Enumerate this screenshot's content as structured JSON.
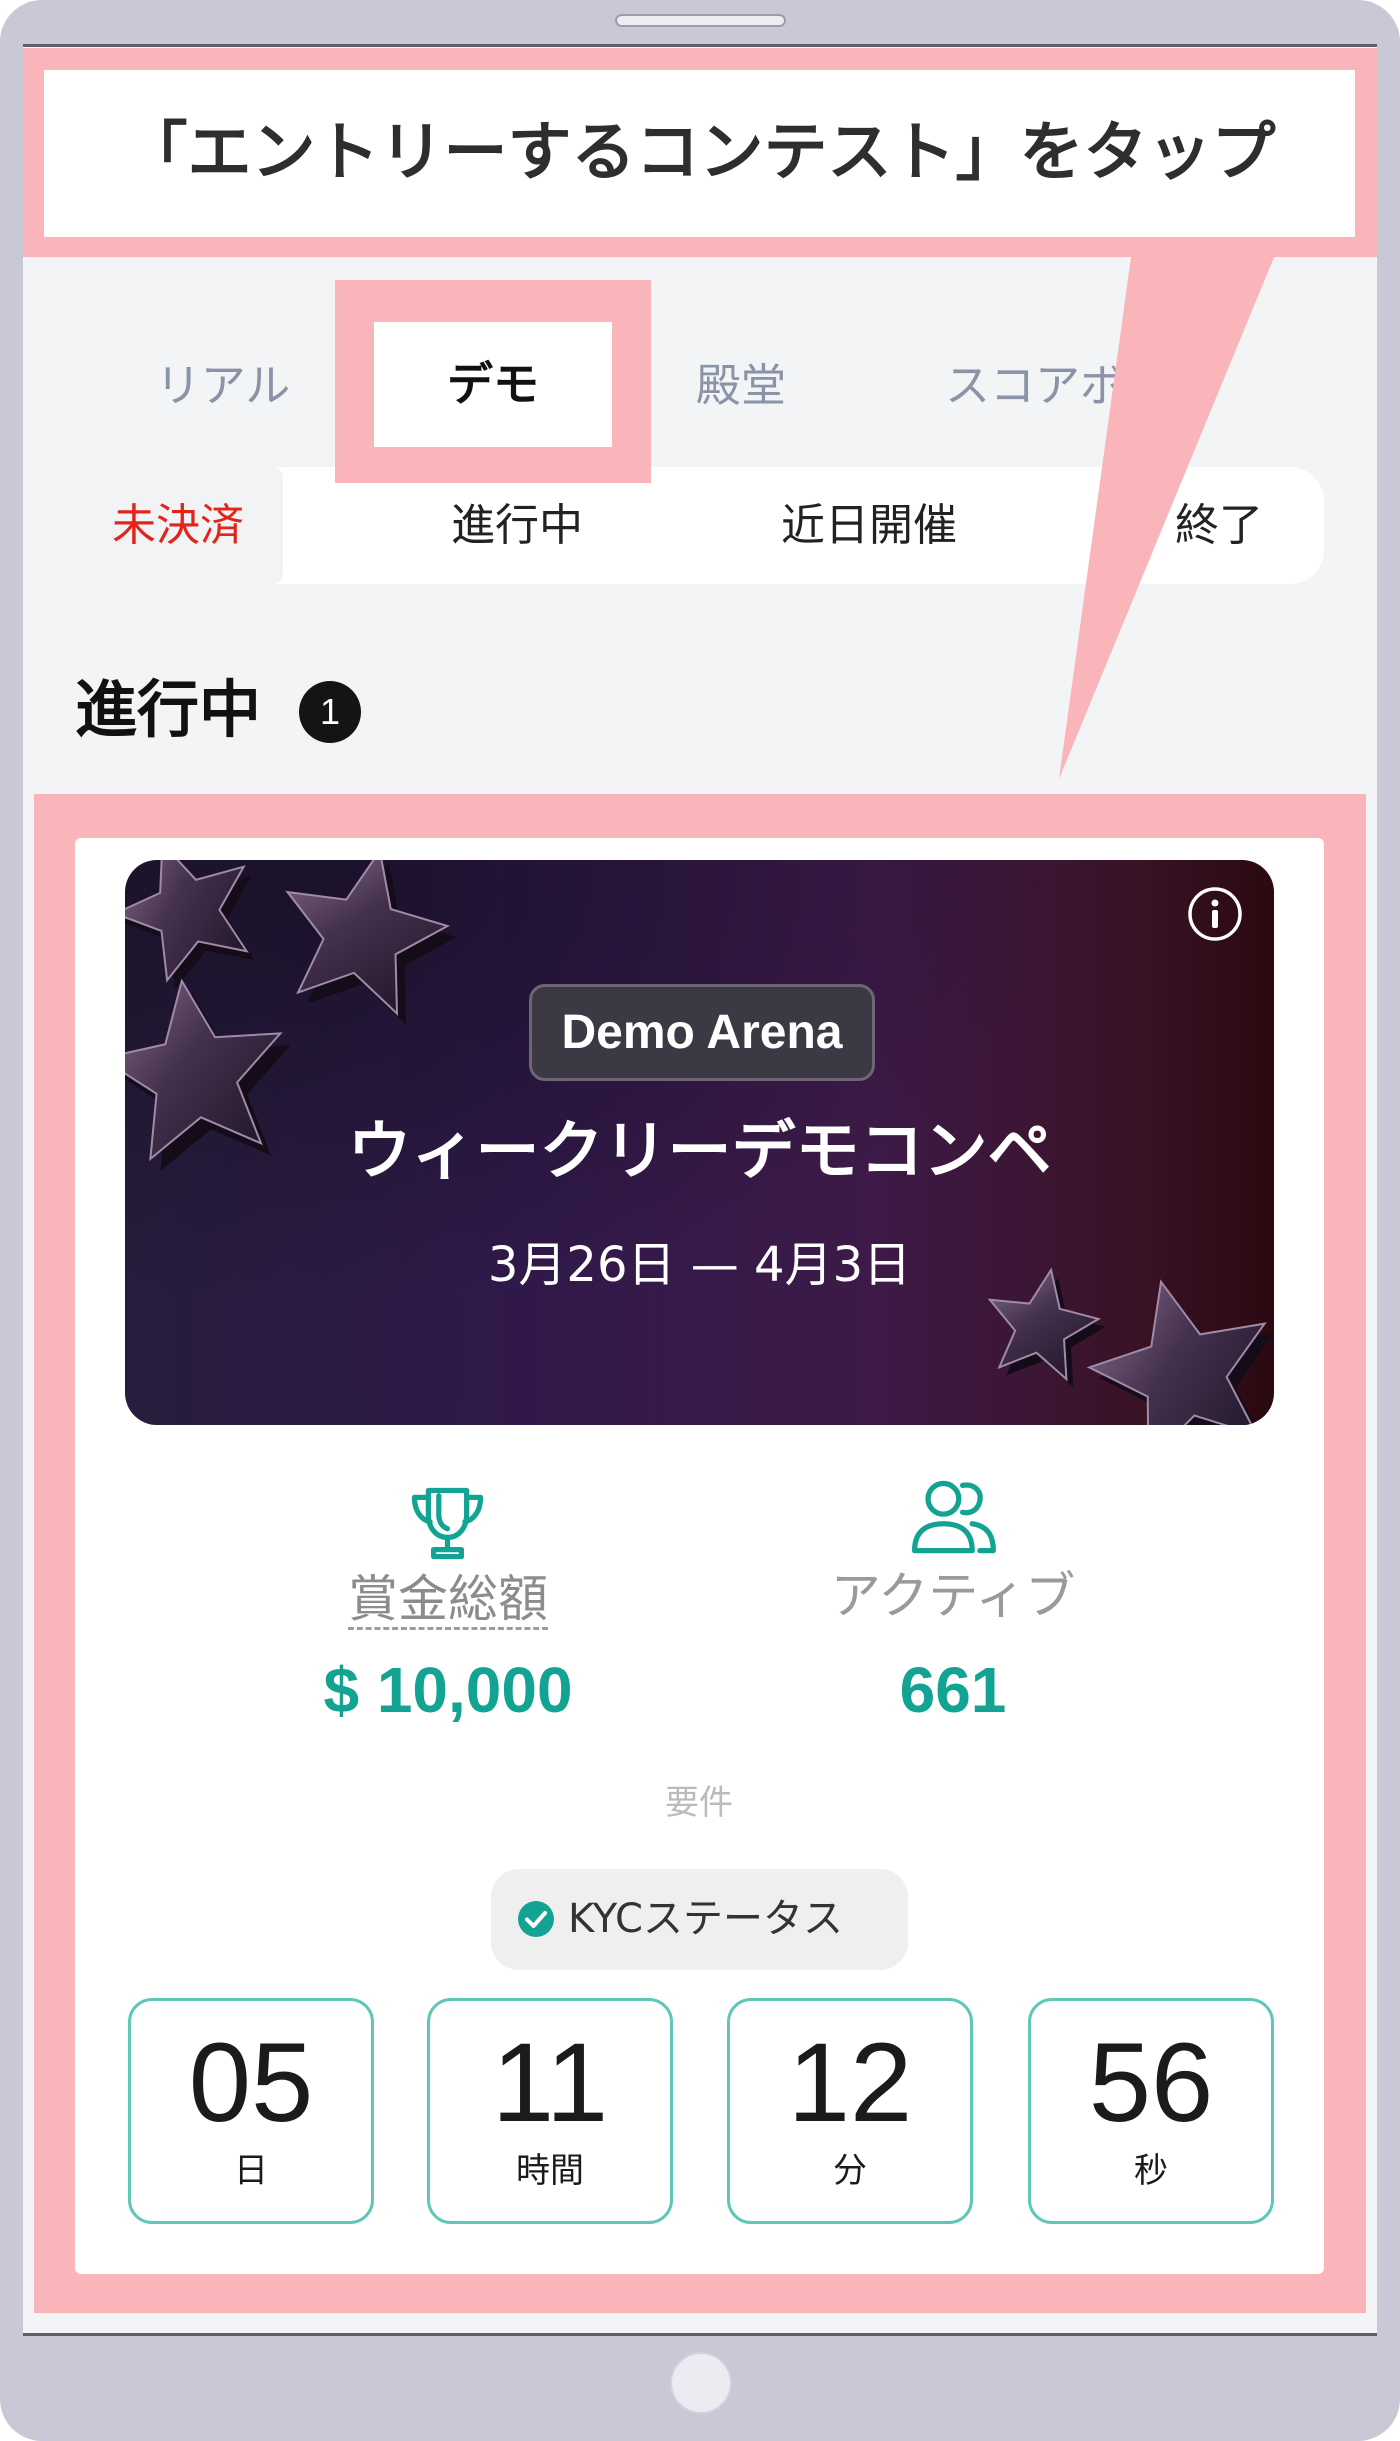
{
  "callout": {
    "text": "「エントリーするコンテスト」をタップ"
  },
  "tabs": [
    {
      "label": "リアル",
      "active": false
    },
    {
      "label": "デモ",
      "active": true
    },
    {
      "label": "殿堂",
      "active": false
    },
    {
      "label": "スコアボ",
      "active": false
    }
  ],
  "subtabs": [
    {
      "label": "未決済",
      "active": true
    },
    {
      "label": "進行中",
      "active": false
    },
    {
      "label": "近日開催",
      "active": false
    },
    {
      "label": "終了",
      "active": false
    }
  ],
  "section": {
    "title": "進行中",
    "count": "1"
  },
  "contest": {
    "badge": "Demo Arena",
    "title": "ウィークリーデモコンペ",
    "dates": "3月26日 — 4月3日",
    "stats": [
      {
        "label": "賞金総額",
        "value": "$ 10,000",
        "icon": "trophy-icon"
      },
      {
        "label": "アクティブ",
        "value": "661",
        "icon": "users-icon"
      }
    ],
    "requirements_label": "要件",
    "requirements": [
      {
        "label": "KYCステータス",
        "icon": "check-circle-icon",
        "met": true
      }
    ],
    "countdown": [
      {
        "value": "05",
        "unit": "日"
      },
      {
        "value": "11",
        "unit": "時間"
      },
      {
        "value": "12",
        "unit": "分"
      },
      {
        "value": "56",
        "unit": "秒"
      }
    ]
  },
  "icons": {
    "info": "info-icon",
    "home": "home-button",
    "decoration": "star-decoration"
  },
  "colors": {
    "accent": "#13a393",
    "highlight": "#f9b5b9",
    "active_subtab": "#e3241b",
    "countdown_border": "#5ec7b6",
    "frame": "#c8c8d6",
    "screen_bg": "#f3f4f6"
  }
}
